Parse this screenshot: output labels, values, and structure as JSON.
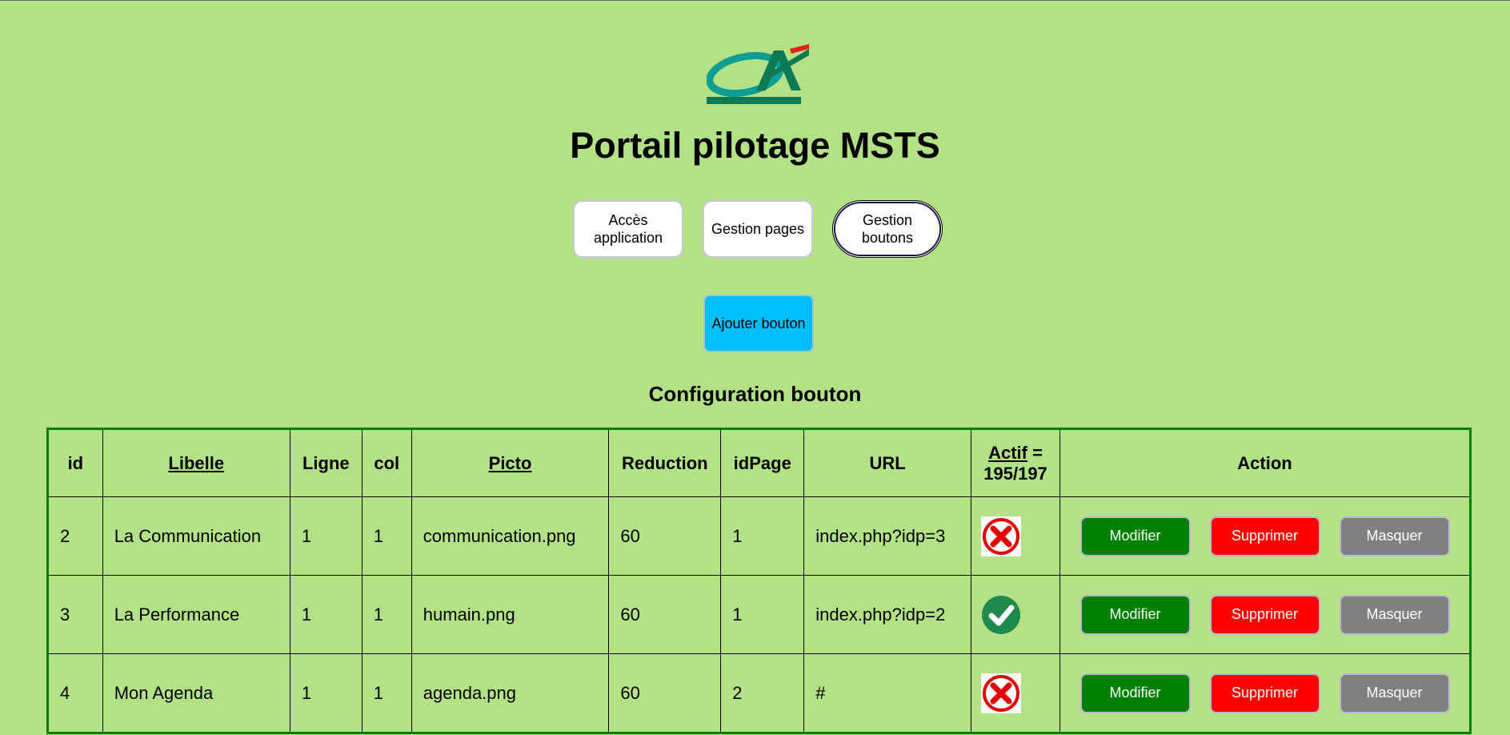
{
  "header": {
    "logo_text": "CA",
    "title": "Portail pilotage MSTS"
  },
  "nav": {
    "items": [
      {
        "label": "Accès application",
        "active": false
      },
      {
        "label": "Gestion pages",
        "active": false
      },
      {
        "label": "Gestion boutons",
        "active": true
      }
    ]
  },
  "add_button": {
    "label": "Ajouter bouton"
  },
  "section": {
    "title": "Configuration bouton"
  },
  "table": {
    "headers": {
      "id": "id",
      "libelle": "Libelle",
      "ligne": "Ligne",
      "col": "col",
      "picto": "Picto",
      "reduction": "Reduction",
      "idpage": "idPage",
      "url": "URL",
      "actif_link": "Actif",
      "actif_suffix": " =",
      "actif_count": "195/197",
      "action": "Action"
    },
    "rows": [
      {
        "id": "2",
        "libelle": "La Communication",
        "ligne": "1",
        "col": "1",
        "picto": "communication.png",
        "reduction": "60",
        "idpage": "1",
        "url": "index.php?idp=3",
        "actif_icon": "red-cross-icon"
      },
      {
        "id": "3",
        "libelle": "La Performance",
        "ligne": "1",
        "col": "1",
        "picto": "humain.png",
        "reduction": "60",
        "idpage": "1",
        "url": "index.php?idp=2",
        "actif_icon": "green-check-icon"
      },
      {
        "id": "4",
        "libelle": "Mon Agenda",
        "ligne": "1",
        "col": "1",
        "picto": "agenda.png",
        "reduction": "60",
        "idpage": "2",
        "url": "#",
        "actif_icon": "red-cross-icon"
      }
    ],
    "actions": {
      "modify": "Modifier",
      "delete": "Supprimer",
      "hide": "Masquer"
    }
  },
  "colors": {
    "background": "#b3e186",
    "table_border": "#008000",
    "add_button": "#00bfff",
    "modify": "#008000",
    "delete": "#ff0000",
    "hide": "#808080"
  }
}
